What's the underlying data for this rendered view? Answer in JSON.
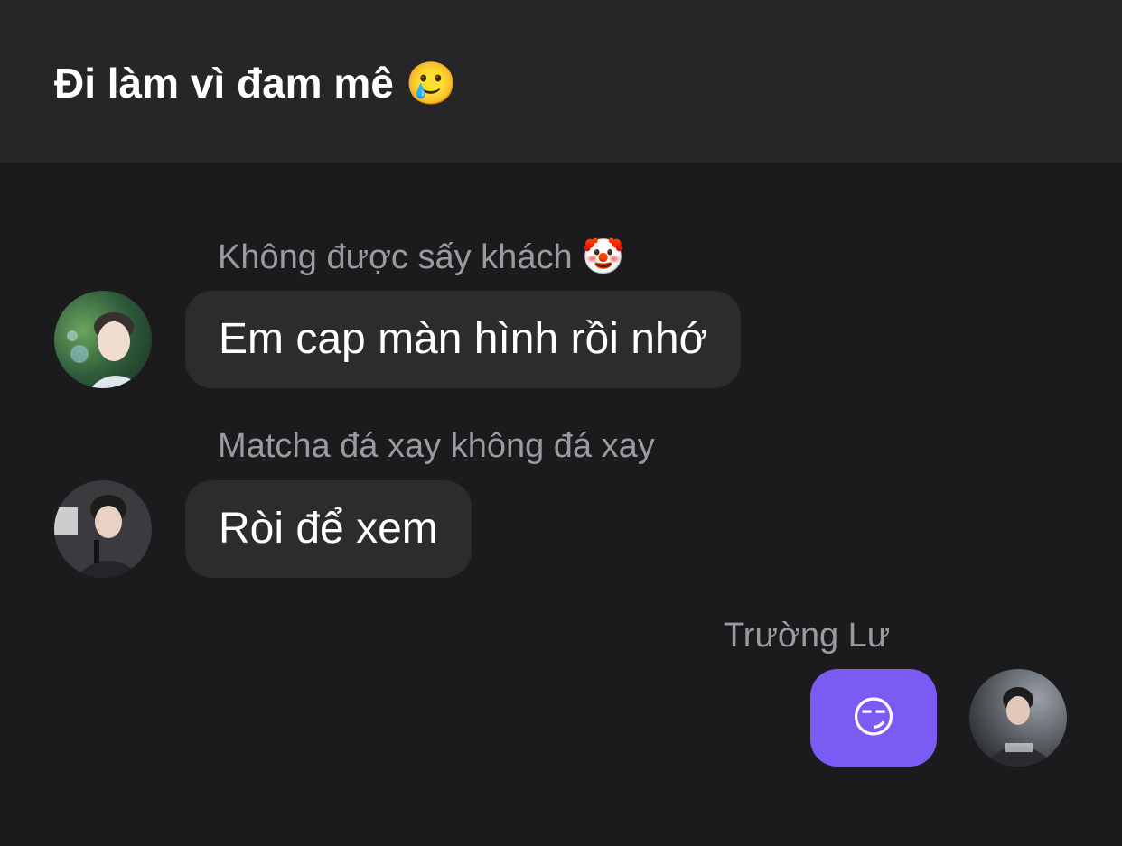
{
  "header": {
    "title": "Đi làm vì đam mê",
    "title_emoji": "🥲"
  },
  "messages": [
    {
      "sender": "Không được sấy khách",
      "sender_emoji": "🤡",
      "text": "Em cap màn hình rồi nhớ",
      "avatar_icon": "user-avatar-photo"
    },
    {
      "sender": "Matcha đá xay không đá xay",
      "text": "Ròi để xem",
      "avatar_icon": "user-avatar-photo"
    },
    {
      "sender": "Trường Lư",
      "text": "😏",
      "avatar_icon": "user-avatar-photo",
      "mine": true
    }
  ],
  "colors": {
    "background": "#1b1b1d",
    "header": "#262628",
    "bubble": "#2c2c2e",
    "my_bubble": "#7a5cf5",
    "sender_text": "#9a9a9f"
  }
}
